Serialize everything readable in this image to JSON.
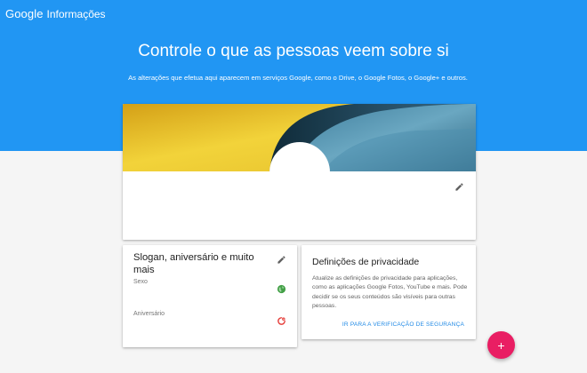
{
  "app": {
    "logo": "Google",
    "product": "Informações"
  },
  "hero": {
    "title": "Controle o que as pessoas veem sobre si",
    "subtitle": "As alterações que efetua aqui aparecem em serviços Google, como o Drive, o Google Fotos, o Google+ e outros."
  },
  "profile_card": {
    "edit_icon": "pencil-icon"
  },
  "about_card": {
    "title": "Slogan, aniversário e muito mais",
    "edit_icon": "pencil-icon",
    "fields": [
      {
        "label": "Sexo",
        "visibility_icon": "globe-icon",
        "icon_color": "#43a047"
      },
      {
        "label": "Aniversário",
        "visibility_icon": "restricted-icon",
        "icon_color": "#e53935"
      }
    ]
  },
  "privacy_card": {
    "title": "Definições de privacidade",
    "text": "Atualize as definições de privacidade para aplicações, como as aplicações Google Fotos, YouTube e mais. Pode decidir se os seus conteúdos são visíveis para outras pessoas.",
    "link": "IR PARA A VERIFICAÇÃO DE SEGURANÇA"
  },
  "fab": {
    "label": "+",
    "icon": "plus-icon"
  },
  "colors": {
    "hero_blue": "#2196f3",
    "link_blue": "#1e88e5",
    "fab_pink": "#e91e63",
    "public_green": "#43a047",
    "restricted_red": "#e53935"
  }
}
